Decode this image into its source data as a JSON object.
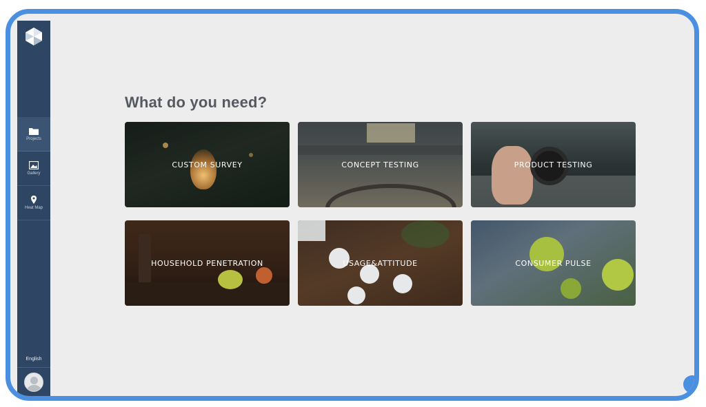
{
  "sidebar": {
    "logo_icon": "hexagon-logo-icon",
    "items": [
      {
        "label": "Projects",
        "icon": "folder-icon",
        "active": true
      },
      {
        "label": "Gallery",
        "icon": "image-icon",
        "active": false
      },
      {
        "label": "Heat Map",
        "icon": "map-pin-icon",
        "active": false
      }
    ],
    "language": "English",
    "avatar_icon": "user-avatar-icon"
  },
  "main": {
    "title": "What do you need?",
    "cards": [
      {
        "label": "CUSTOM SURVEY"
      },
      {
        "label": "CONCEPT TESTING"
      },
      {
        "label": "PRODUCT TESTING"
      },
      {
        "label": "HOUSEHOLD PENETRATION"
      },
      {
        "label": "USAGE&ATTITUDE"
      },
      {
        "label": "CONSUMER PULSE"
      }
    ]
  },
  "colors": {
    "frame": "#4a8fe0",
    "sidebar": "#2e4663",
    "background": "#ededee"
  }
}
